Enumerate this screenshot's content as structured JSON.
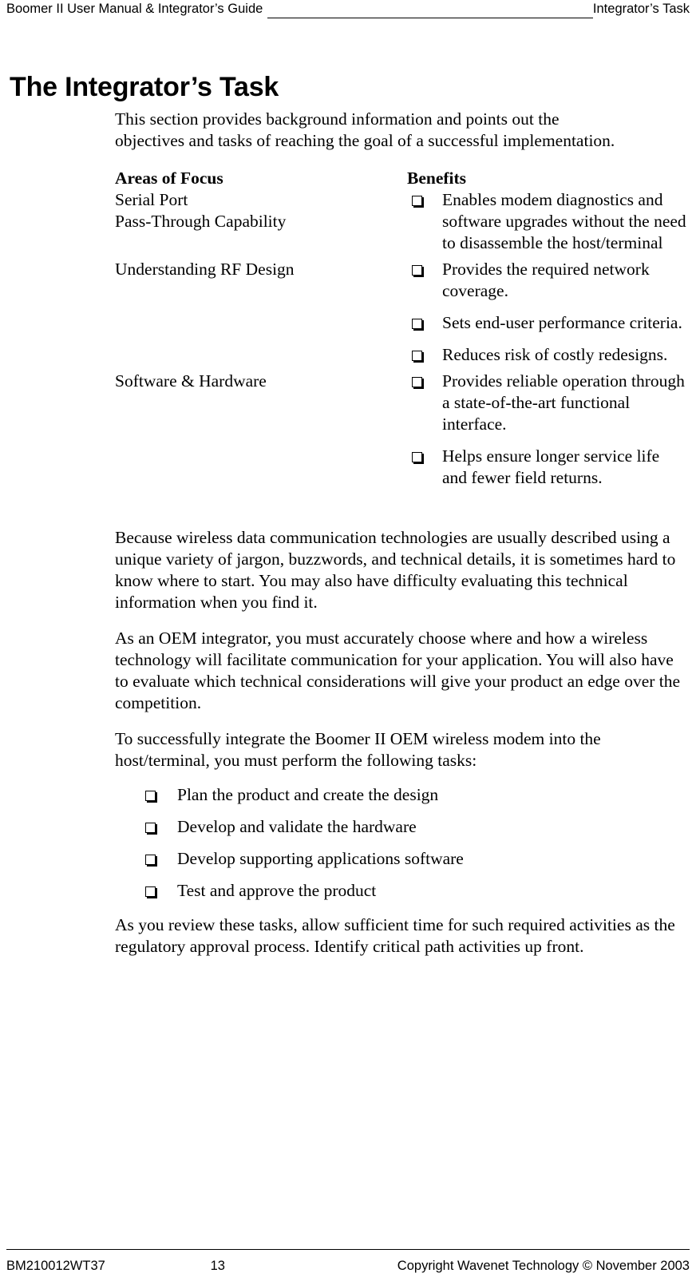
{
  "header": {
    "left": "Boomer II User Manual & Integrator’s Guide",
    "right": "Integrator’s Task"
  },
  "title": "The Integrator’s Task",
  "intro": "This section provides background information and points out the objectives and tasks of reaching the goal of a successful implementation.",
  "table": {
    "col1_header": "Areas of Focus",
    "col2_header": "Benefits",
    "rows": [
      {
        "focus": "Serial Port\nPass-Through Capability",
        "benefits": [
          "Enables modem diagnostics and software upgrades without the need to disassemble the host/terminal"
        ]
      },
      {
        "focus": "Understanding RF Design",
        "benefits": [
          "Provides the required network coverage.",
          "Sets end-user performance criteria.",
          "Reduces risk of costly redesigns."
        ]
      },
      {
        "focus": "Software & Hardware",
        "benefits": [
          "Provides reliable operation through a state-of-the-art functional interface.",
          "Helps ensure longer service life and fewer field returns."
        ]
      }
    ]
  },
  "paragraphs": {
    "p1": "Because wireless data communication technologies are usually described using a unique variety of jargon, buzzwords, and technical details, it is sometimes hard to know where to start. You may also have difficulty evaluating this technical information when you find it.",
    "p2": "As an OEM integrator, you must accurately choose where and how a wireless technology will facilitate communication for your application. You will also have to evaluate which technical considerations will give your product an edge over the competition.",
    "p3": "To successfully integrate the Boomer II OEM wireless modem into the host/terminal, you must perform the following tasks:",
    "p4": "As you review these tasks, allow sufficient time for such required activities as the regulatory approval process. Identify critical path activities up front."
  },
  "tasks": [
    "Plan the product and create the design",
    "Develop and validate the hardware",
    "Develop supporting applications software",
    "Test and approve the product"
  ],
  "footer": {
    "doc_number": "BM210012WT37",
    "page_number": "13",
    "copyright": "Copyright Wavenet Technology © November 2003"
  }
}
